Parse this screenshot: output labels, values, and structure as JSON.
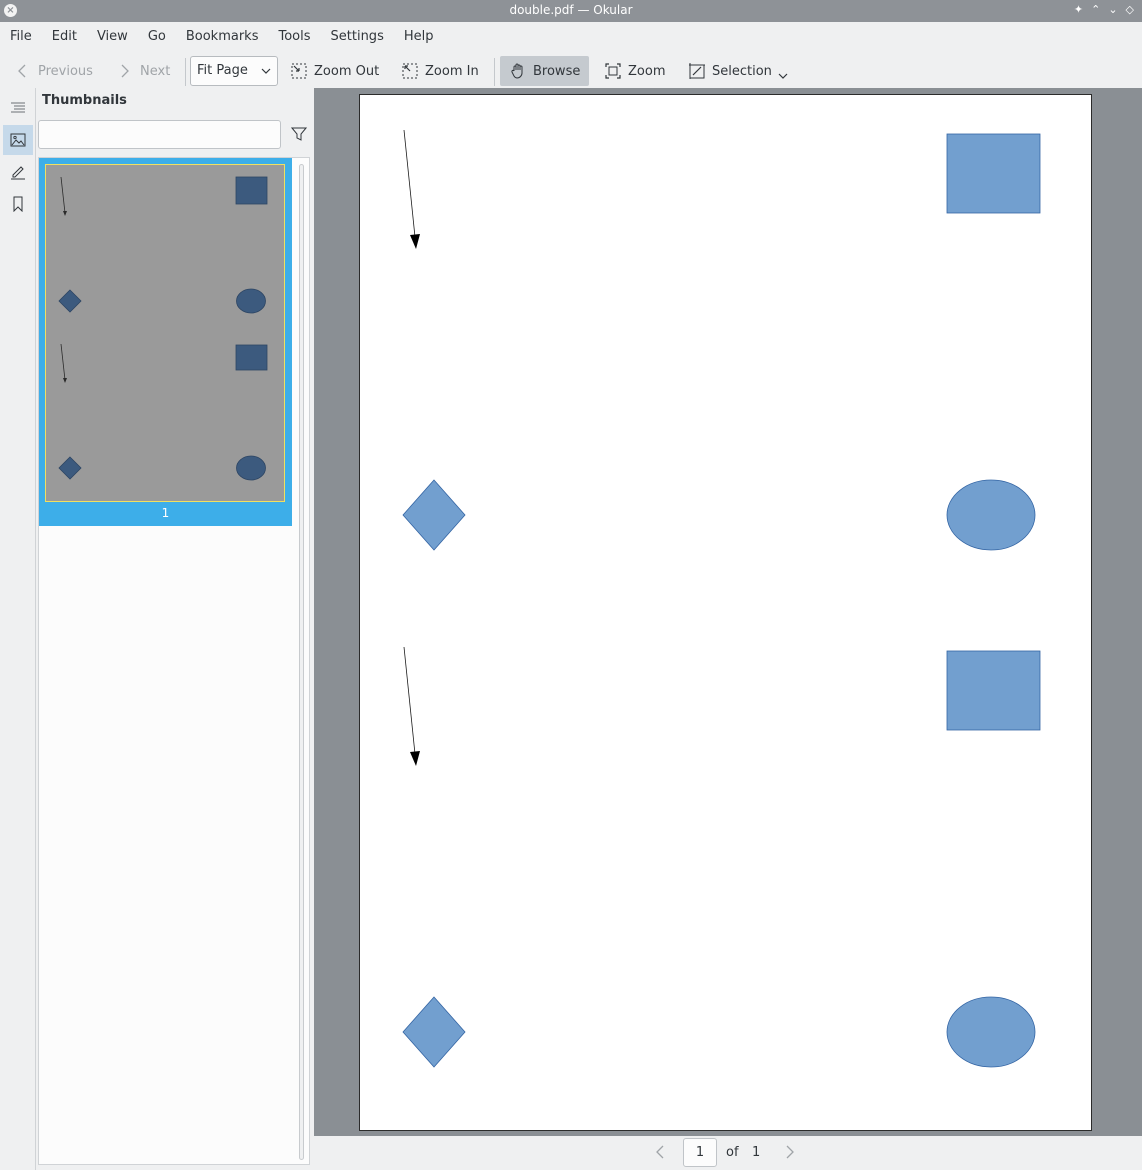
{
  "window": {
    "title": "double.pdf — Okular"
  },
  "menu": [
    "File",
    "Edit",
    "View",
    "Go",
    "Bookmarks",
    "Tools",
    "Settings",
    "Help"
  ],
  "toolbar": {
    "previous": "Previous",
    "next": "Next",
    "zoom_mode": "Fit Page",
    "zoom_out": "Zoom Out",
    "zoom_in": "Zoom In",
    "browse": "Browse",
    "zoom": "Zoom",
    "selection": "Selection"
  },
  "sidebar": {
    "panel_title": "Thumbnails",
    "search_value": "",
    "thumbnails": [
      {
        "label": "1"
      }
    ]
  },
  "pager": {
    "current": "1",
    "of": "of",
    "total": "1"
  },
  "colors": {
    "shape_fill": "#729fcf",
    "thumb_shape_fill": "#3c5a7e",
    "thumb_bg": "#9a9a9a",
    "selection": "#3daee9",
    "viewer_bg": "#8a8f94"
  }
}
